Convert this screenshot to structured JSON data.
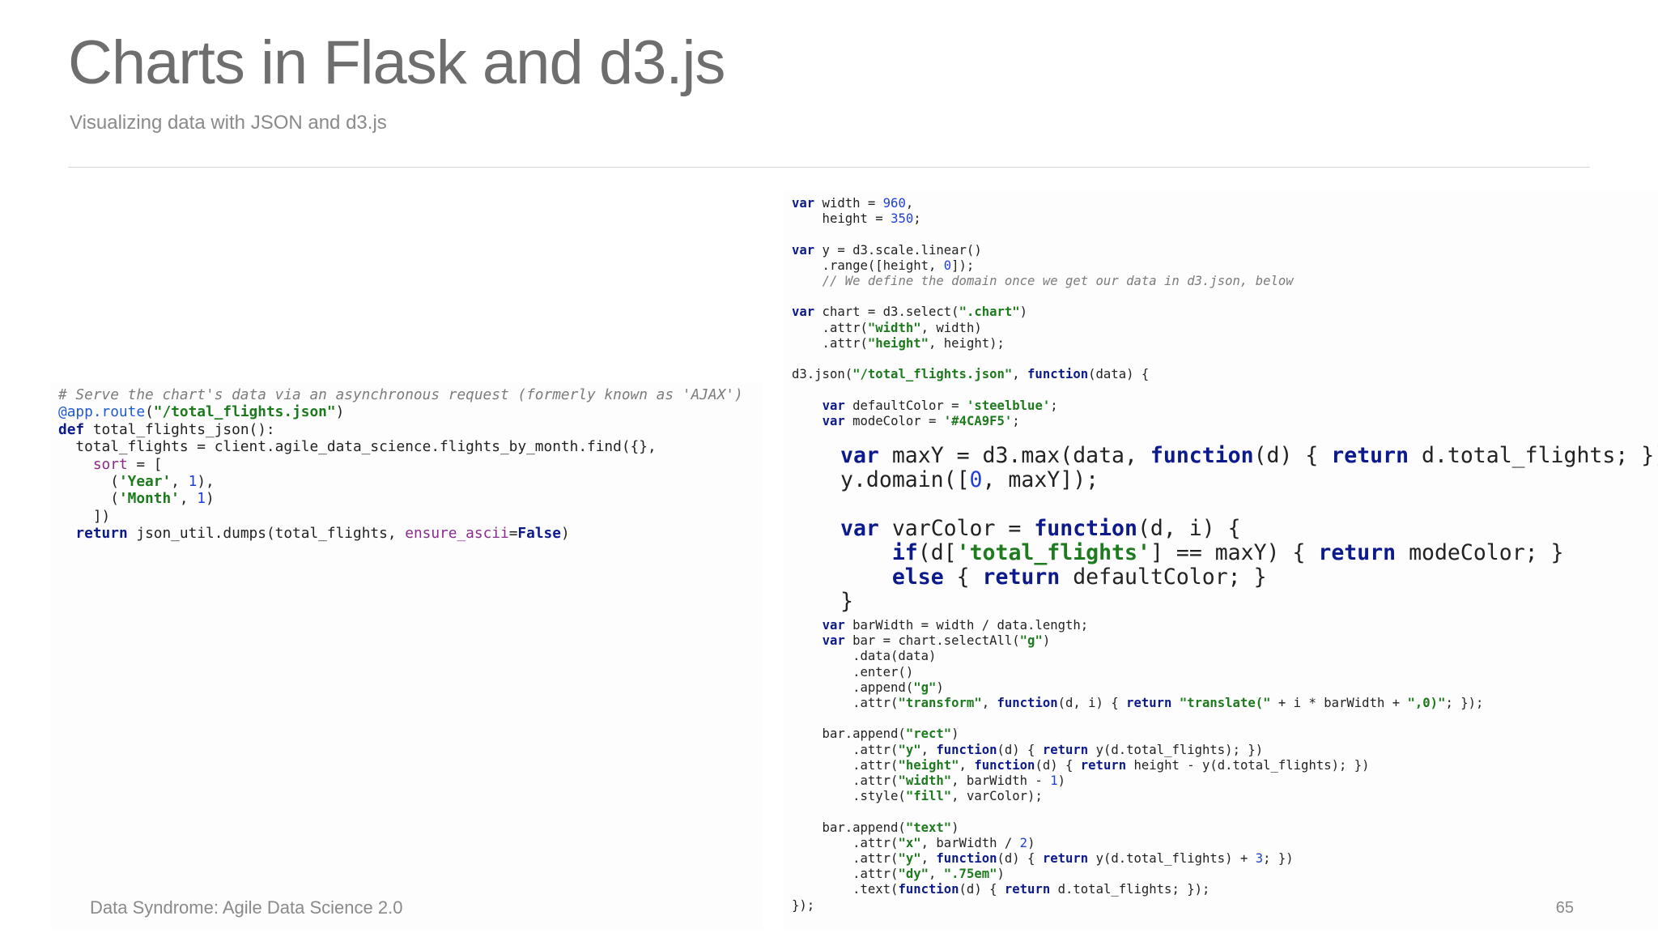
{
  "slide": {
    "title": "Charts in Flask and d3.js",
    "subtitle": "Visualizing data with JSON and d3.js",
    "footer": "Data Syndrome: Agile Data Science 2.0",
    "page_number": "65"
  },
  "code_left": {
    "language": "python",
    "text": "# Serve the chart's data via an asynchronous request (formerly known as 'AJAX')\n@app.route(\"/total_flights.json\")\ndef total_flights_json():\n  total_flights = client.agile_data_science.flights_by_month.find({},\n    sort = [\n      ('Year', 1),\n      ('Month', 1)\n    ])\n  return json_util.dumps(total_flights, ensure_ascii=False)"
  },
  "code_right": {
    "language": "javascript",
    "top_text": "var width = 960,\n    height = 350;\n\nvar y = d3.scale.linear()\n    .range([height, 0]);\n    // We define the domain once we get our data in d3.json, below\n\nvar chart = d3.select(\".chart\")\n    .attr(\"width\", width)\n    .attr(\"height\", height);\n\nd3.json(\"/total_flights.json\", function(data) {\n\n    var defaultColor = 'steelblue';\n    var modeColor = '#4CA9F5';",
    "big_text": "var maxY = d3.max(data, function(d) { return d.total_flights; });\ny.domain([0, maxY]);\n\nvar varColor = function(d, i) {\n    if(d['total_flights'] == maxY) { return modeColor; }\n    else { return defaultColor; }\n}",
    "bottom_text": "    var barWidth = width / data.length;\n    var bar = chart.selectAll(\"g\")\n        .data(data)\n        .enter()\n        .append(\"g\")\n        .attr(\"transform\", function(d, i) { return \"translate(\" + i * barWidth + \",0)\"; });\n\n    bar.append(\"rect\")\n        .attr(\"y\", function(d) { return y(d.total_flights); })\n        .attr(\"height\", function(d) { return height - y(d.total_flights); })\n        .attr(\"width\", barWidth - 1)\n        .style(\"fill\", varColor);\n\n    bar.append(\"text\")\n        .attr(\"x\", barWidth / 2)\n        .attr(\"y\", function(d) { return y(d.total_flights) + 3; })\n        .attr(\"dy\", \".75em\")\n        .text(function(d) { return d.total_flights; });\n});"
  },
  "syntax_colors": {
    "keyword": "#0d1a8c",
    "string": "#1d7a1d",
    "number": "#1f3fd8",
    "comment": "#7c7c7c",
    "decorator": "#1f5ad0",
    "param": "#8a2a8a",
    "text": "#222222"
  }
}
